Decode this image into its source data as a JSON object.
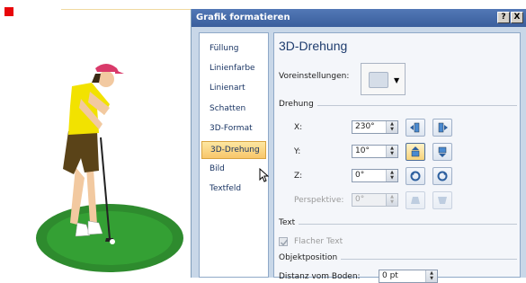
{
  "dialog": {
    "title": "Grafik formatieren",
    "help_label": "?",
    "close_label": "X"
  },
  "categories": [
    {
      "label": "Füllung"
    },
    {
      "label": "Linienfarbe"
    },
    {
      "label": "Linienart"
    },
    {
      "label": "Schatten"
    },
    {
      "label": "3D-Format"
    },
    {
      "label": "3D-Drehung",
      "selected": true
    },
    {
      "label": "Bild"
    },
    {
      "label": "Textfeld"
    }
  ],
  "panel": {
    "heading": "3D-Drehung",
    "presets_label": "Voreinstellungen:",
    "rotation_section": "Drehung",
    "x_label": "X:",
    "x_value": "230°",
    "y_label": "Y:",
    "y_value": "10°",
    "z_label": "Z:",
    "z_value": "0°",
    "perspective_label": "Perspektive:",
    "perspective_value": "0°",
    "text_section": "Text",
    "flat_text_label": "Flacher Text",
    "position_section": "Objektposition",
    "distance_label": "Distanz vom Boden:",
    "distance_value": "0 pt"
  },
  "colors": {
    "title_bar": "#3f63a3",
    "selected_tab": "#f8c66a",
    "panel_bg": "#f4f6fa",
    "selection_handle": "#e8060a"
  },
  "icons": [
    "left-rotate-icon",
    "right-rotate-icon",
    "up-tilt-icon",
    "down-tilt-icon",
    "ccw-rotate-icon",
    "cw-rotate-icon",
    "narrow-perspective-icon",
    "widen-perspective-icon",
    "checkmark-icon",
    "pointer-cursor-icon"
  ]
}
